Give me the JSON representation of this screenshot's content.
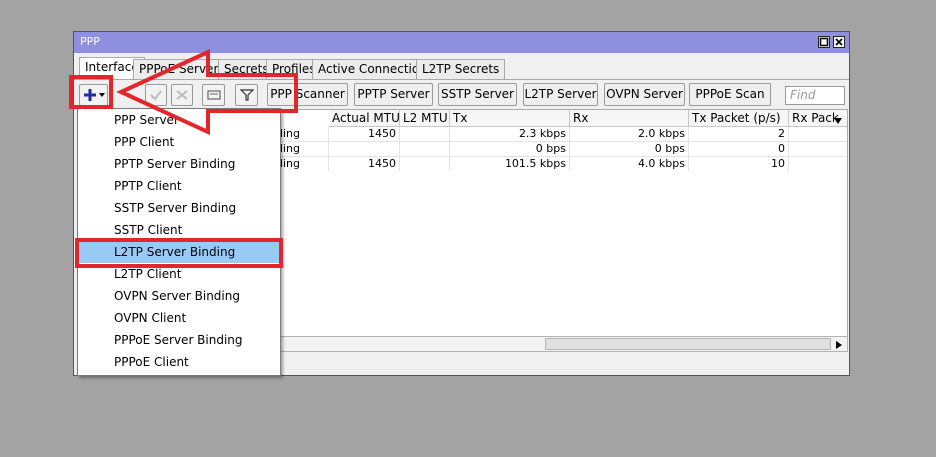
{
  "window": {
    "title": "PPP"
  },
  "tabs": [
    "Interface",
    "PPPoE Servers",
    "Secrets",
    "Profiles",
    "Active Connections",
    "L2TP Secrets"
  ],
  "toolbar": {
    "buttons": [
      "PPP Scanner",
      "PPTP Server",
      "SSTP Server",
      "L2TP Server",
      "OVPN Server",
      "PPPoE Scan"
    ],
    "find_placeholder": "Find"
  },
  "table": {
    "columns": [
      "Actual MTU",
      "L2 MTU",
      "Tx",
      "Rx",
      "Tx Packet (p/s)",
      "Rx Pack"
    ],
    "rows": [
      {
        "name_tail": "nding",
        "actual_mtu": "1450",
        "l2_mtu": "",
        "tx": "2.3 kbps",
        "rx": "2.0 kbps",
        "tx_packet": "2",
        "rx_packet": ""
      },
      {
        "name_tail": "nding",
        "actual_mtu": "",
        "l2_mtu": "",
        "tx": "0 bps",
        "rx": "0 bps",
        "tx_packet": "0",
        "rx_packet": ""
      },
      {
        "name_tail": "nding",
        "actual_mtu": "1450",
        "l2_mtu": "",
        "tx": "101.5 kbps",
        "rx": "4.0 kbps",
        "tx_packet": "10",
        "rx_packet": ""
      }
    ]
  },
  "menu": {
    "items": [
      "PPP Server",
      "PPP Client",
      "PPTP Server Binding",
      "PPTP Client",
      "SSTP Server Binding",
      "SSTP Client",
      "L2TP Server Binding",
      "L2TP Client",
      "OVPN Server Binding",
      "OVPN Client",
      "PPPoE Server Binding",
      "PPPoE Client"
    ],
    "selected_index": 6
  },
  "icons": [
    "plus-icon",
    "minus-icon",
    "check-icon",
    "cross-icon",
    "comment-icon",
    "filter-icon",
    "maximize-icon",
    "close-icon",
    "dropdown-arrow-icon",
    "scroll-right-icon"
  ],
  "colors": {
    "titlebar": "#8f8fdf",
    "selection": "#99c9f5",
    "annotation": "#e3262c"
  }
}
